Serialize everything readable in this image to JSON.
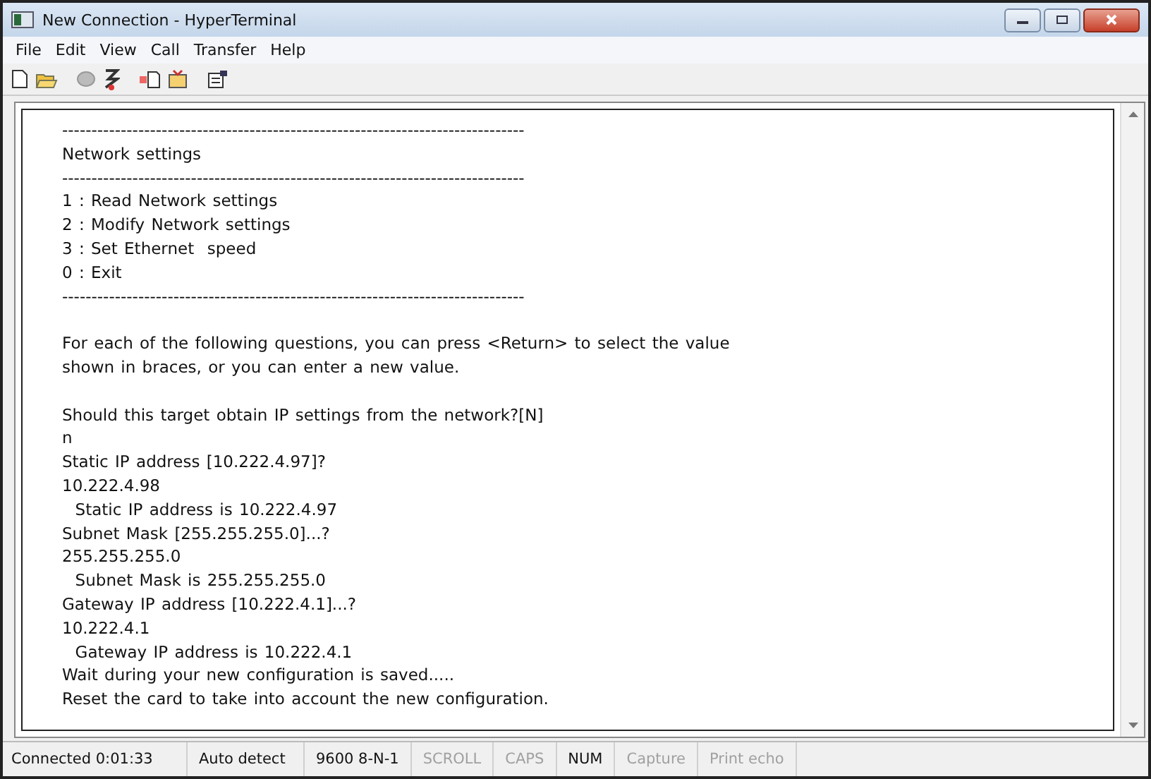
{
  "window": {
    "title": "New Connection - HyperTerminal"
  },
  "menu": [
    "File",
    "Edit",
    "View",
    "Call",
    "Transfer",
    "Help"
  ],
  "terminal": {
    "blocks": [
      [
        "-------------------------------------------------------------------------------",
        "Network settings",
        "-------------------------------------------------------------------------------",
        "1 : Read Network settings",
        "2 : Modify Network settings",
        "3 : Set Ethernet  speed",
        "0 : Exit",
        "-------------------------------------------------------------------------------"
      ],
      [
        "For each of the following questions, you can press <Return> to select the value",
        "shown in braces, or you can enter a new value."
      ],
      [
        "Should this target obtain IP settings from the network?[N]",
        "n",
        "Static IP address [10.222.4.97]?",
        "10.222.4.98",
        "  Static IP address is 10.222.4.97",
        "Subnet Mask [255.255.255.0]...?",
        "255.255.255.0",
        "  Subnet Mask is 255.255.255.0",
        "Gateway IP address [10.222.4.1]...?",
        "10.222.4.1",
        "  Gateway IP address is 10.222.4.1",
        "Wait during your new configuration is saved.....",
        "Reset the card to take into account the new configuration."
      ]
    ]
  },
  "status_bar": [
    {
      "text": "Connected 0:01:33",
      "enabled": true
    },
    {
      "text": "Auto detect",
      "enabled": true
    },
    {
      "text": "9600 8-N-1",
      "enabled": true
    },
    {
      "text": "SCROLL",
      "enabled": false
    },
    {
      "text": "CAPS",
      "enabled": false
    },
    {
      "text": "NUM",
      "enabled": true
    },
    {
      "text": "Capture",
      "enabled": false
    },
    {
      "text": "Print echo",
      "enabled": false
    }
  ]
}
